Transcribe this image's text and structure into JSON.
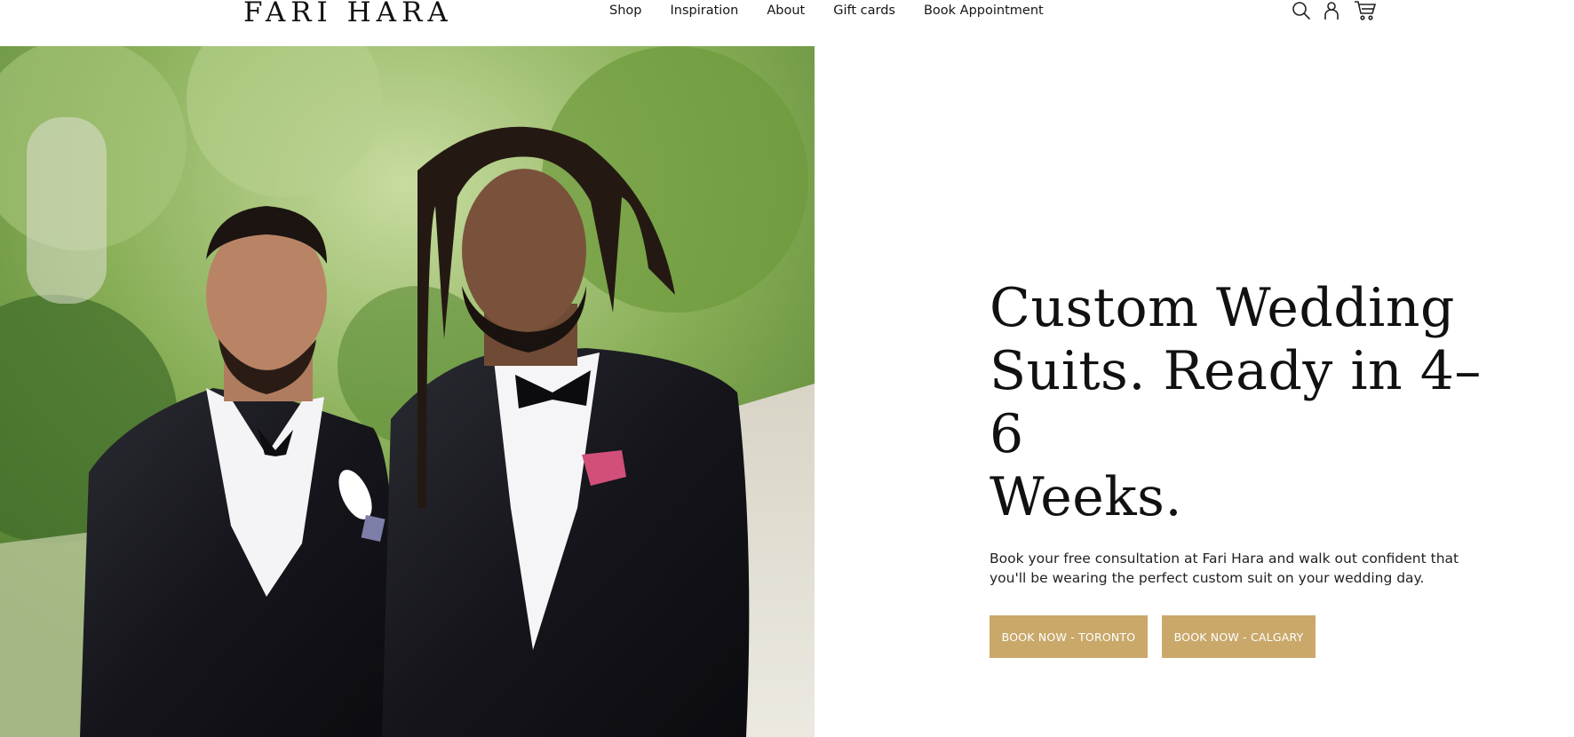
{
  "brand": {
    "logo_text": "FARI HARA"
  },
  "nav": {
    "items": [
      {
        "label": "Shop"
      },
      {
        "label": "Inspiration"
      },
      {
        "label": "About"
      },
      {
        "label": "Gift cards"
      },
      {
        "label": "Book Appointment"
      }
    ]
  },
  "header_icons": [
    "search-icon",
    "account-icon",
    "cart-icon"
  ],
  "hero": {
    "headline_line1": "Custom Wedding",
    "headline_line2": "Suits. Ready in 4–6",
    "headline_line3": "Weeks.",
    "subtext": "Book your free consultation at Fari Hara and walk out confident that you'll be wearing the perfect custom suit on your wedding day.",
    "buttons": [
      {
        "label": "BOOK NOW - TORONTO"
      },
      {
        "label": "BOOK NOW - CALGARY"
      }
    ]
  },
  "colors": {
    "accent": "#c9a86a",
    "text": "#111111",
    "background": "#ffffff"
  }
}
